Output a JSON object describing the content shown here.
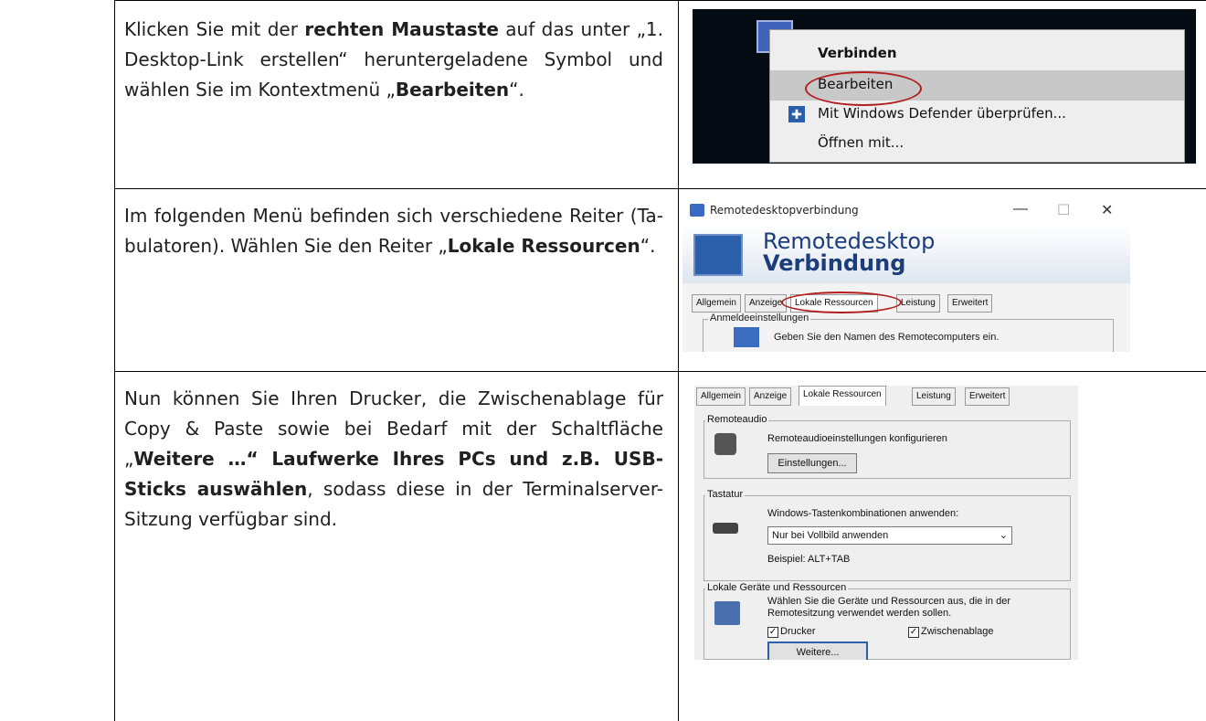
{
  "rows": [
    {
      "text_parts": [
        "Klicken Sie mit der ",
        "rechten Maustaste",
        " auf das unter „1. Desktop-Link erstellen“ heruntergeladene Symbol und wählen Sie im Kontextmenü „",
        "Bearbeiten",
        "“."
      ]
    },
    {
      "text_parts": [
        "Im folgenden Menü befinden sich verschiedene Reiter (Ta-bulatoren). Wählen Sie den Reiter „",
        "Lokale Ressourcen",
        "“."
      ]
    },
    {
      "text_parts": [
        "Nun können Sie Ihren Drucker, die Zwischenablage für Copy & Paste sowie bei Bedarf mit der Schaltfläche „",
        "Weitere …“ Laufwerke Ihres PCs und z.B. USB-Sticks auswählen",
        ", sodass diese in der Terminalserver-Sitzung verfügbar sind."
      ]
    }
  ],
  "shot1": {
    "menu_items": [
      "Verbinden",
      "Bearbeiten",
      "Mit Windows Defender überprüfen...",
      "Öffnen mit..."
    ],
    "highlight_color": "#b21e1e"
  },
  "shot2": {
    "window_title": "Remotedesktopverbindung",
    "banner_line1": "Remotedesktop",
    "banner_line2": "Verbindung",
    "tabs": [
      "Allgemein",
      "Anzeige",
      "Lokale Ressourcen",
      "Leistung",
      "Erweitert"
    ],
    "group_label": "Anmeldeeinstellungen",
    "group_text": "Geben Sie den Namen des Remotecomputers ein.",
    "window_buttons": [
      "—",
      "☐",
      "✕"
    ]
  },
  "shot3": {
    "tabs": [
      "Allgemein",
      "Anzeige",
      "Lokale Ressourcen",
      "Leistung",
      "Erweitert"
    ],
    "audio_label": "Remoteaudio",
    "audio_text": "Remoteaudioeinstellungen konfigurieren",
    "audio_button": "Einstellungen...",
    "keyboard_label": "Tastatur",
    "keyboard_text": "Windows-Tastenkombinationen anwenden:",
    "keyboard_select": "Nur bei Vollbild anwenden",
    "keyboard_example": "Beispiel: ALT+TAB",
    "devices_label": "Lokale Geräte und Ressourcen",
    "devices_text1": "Wählen Sie die Geräte und Ressourcen aus, die in der",
    "devices_text2": "Remotesitzung verwendet werden sollen.",
    "printer_label": "Drucker",
    "clipboard_label": "Zwischenablage",
    "more_button": "Weitere..."
  }
}
